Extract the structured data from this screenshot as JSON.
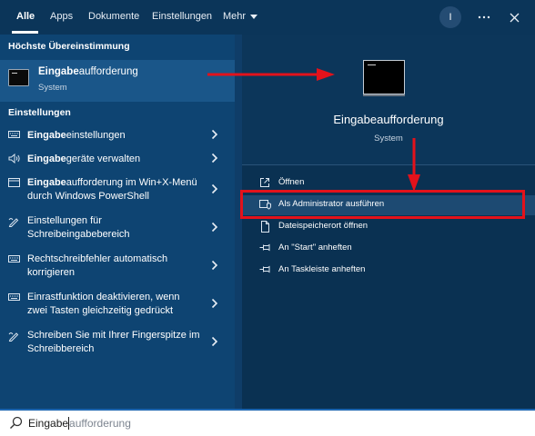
{
  "nav": {
    "tabs": [
      "Alle",
      "Apps",
      "Dokumente",
      "Einstellungen"
    ],
    "more_label": "Mehr",
    "avatar_initial": "I",
    "overflow_icon": "ellipsis-icon",
    "close_icon": "close-icon"
  },
  "best_match": {
    "header": "Höchste Übereinstimmung",
    "title": "Eingabeaufforderung",
    "subtitle": "System"
  },
  "settings": {
    "header": "Einstellungen",
    "items": [
      {
        "icon": "keyboard-icon",
        "label": "Eingabeeinstellungen"
      },
      {
        "icon": "speaker-icon",
        "label": "Eingabegeräte verwalten"
      },
      {
        "icon": "terminal-icon",
        "label": "Eingabeaufforderung im Win+X-Menü durch Windows PowerShell"
      },
      {
        "icon": "pen-icon",
        "label": "Einstellungen für Schreibeingabebereich"
      },
      {
        "icon": "keyboard-icon",
        "label": "Rechtschreibfehler automatisch korrigieren"
      },
      {
        "icon": "keyboard-icon",
        "label": "Einrastfunktion deaktivieren, wenn zwei Tasten gleichzeitig gedrückt"
      },
      {
        "icon": "pen-icon",
        "label": "Schreiben Sie mit Ihrer Fingerspitze im Schreibbereich"
      }
    ]
  },
  "detail": {
    "title": "Eingabeaufforderung",
    "subtitle": "System",
    "actions": [
      {
        "icon": "open-icon",
        "label": "Öffnen"
      },
      {
        "icon": "shield-icon",
        "label": "Als Administrator ausführen"
      },
      {
        "icon": "folder-icon",
        "label": "Dateispeicherort öffnen"
      },
      {
        "icon": "pin-icon",
        "label": "An \"Start\" anheften"
      },
      {
        "icon": "pin-icon",
        "label": "An Taskleiste anheften"
      }
    ]
  },
  "search": {
    "typed": "Eingabe",
    "suggestion": "aufforderung"
  },
  "colors": {
    "highlight_box": "#e3121b",
    "arrow": "#e3121b",
    "background": "#0f3d68"
  }
}
